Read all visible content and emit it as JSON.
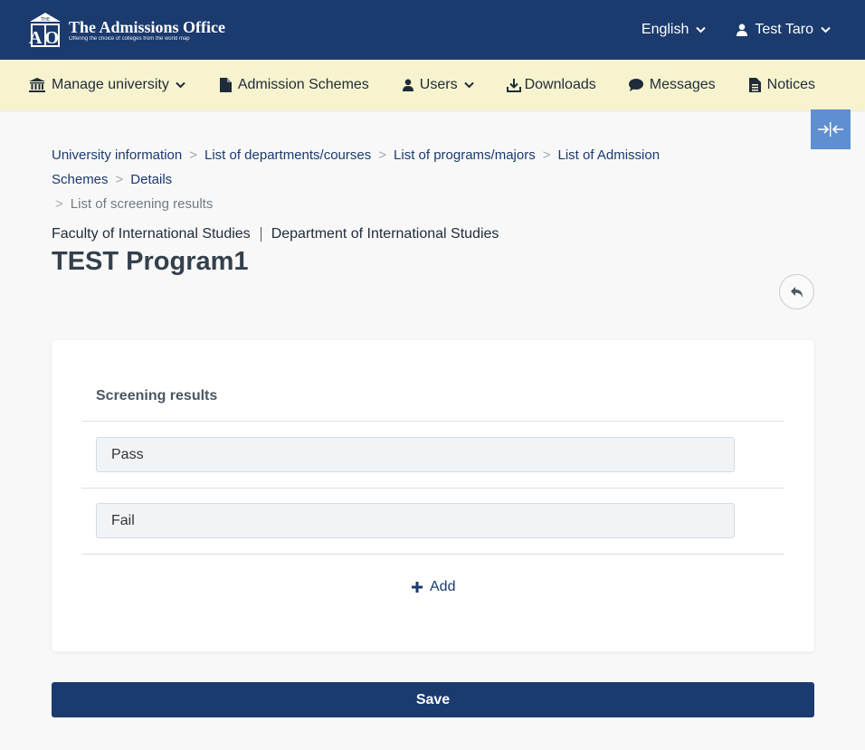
{
  "header": {
    "logo_title": "The Admissions Office",
    "logo_tagline": "Offering the choice of colleges from the world map",
    "logo_mark_top": "THE",
    "logo_mark_letters": "AO",
    "language": "English",
    "user": "Test Taro"
  },
  "nav": {
    "items": [
      {
        "label": "Manage university",
        "icon": "institution-icon"
      },
      {
        "label": "Admission Schemes",
        "icon": "file-icon"
      },
      {
        "label": "Users",
        "icon": "user-icon"
      },
      {
        "label": "Downloads",
        "icon": "download-icon"
      },
      {
        "label": "Messages",
        "icon": "comment-icon"
      },
      {
        "label": "Notices",
        "icon": "file-text-icon"
      }
    ]
  },
  "breadcrumb": {
    "items": [
      "University information",
      "List of departments/courses",
      "List of programs/majors",
      "List of Admission Schemes",
      "Details"
    ],
    "current": "List of screening results",
    "separator": ">"
  },
  "page": {
    "faculty": "Faculty of International Studies",
    "department": "Department of International Studies",
    "program_title": "TEST Program1"
  },
  "card": {
    "title": "Screening results",
    "results": [
      "Pass",
      "Fail"
    ],
    "add_label": "Add"
  },
  "save_label": "Save",
  "colors": {
    "header_bg": "#1b3a6e",
    "nav_bg": "#f7f3cf",
    "collapse_bg": "#5f8fd0"
  }
}
